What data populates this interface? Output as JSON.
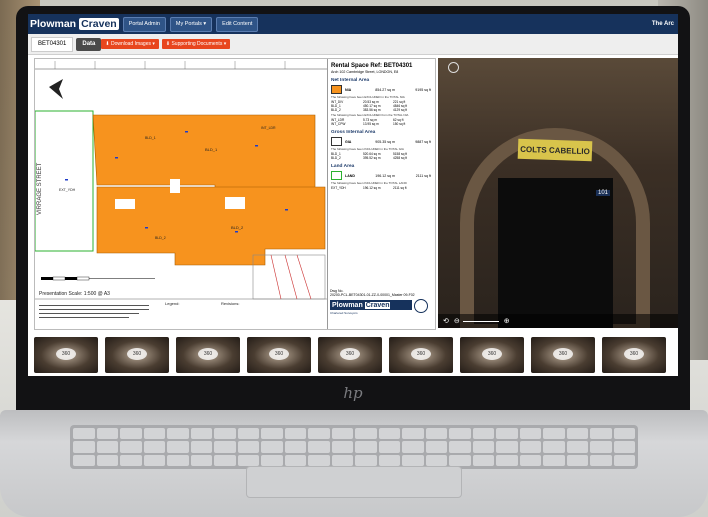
{
  "app": {
    "brand_part1": "Plowman",
    "brand_part2": "Craven",
    "nav": [
      "Portal Admin",
      "My Portals ▾",
      "Edit Content"
    ],
    "right_title": "The Arc"
  },
  "tabs": {
    "ref": "BET04301",
    "data": "Data",
    "download": "⬇ Download Images ▾",
    "supporting": "⬇ Supporting Documents ▾"
  },
  "panel": {
    "title": "Rental Space Ref: BET04301",
    "address": "Arch 102 Cambridge Street, LONDON, E8",
    "nia_heading": "Net Internal Area",
    "nia": {
      "key": "NIA",
      "sqm": "854.27 sq m",
      "sqft": "9195 sq ft"
    },
    "nia_note": "The following have been EXCLUDED in the TOTAL NIA",
    "nia_rows": [
      [
        "INT_DIV",
        "20.53 sq m",
        "221 sq ft"
      ],
      [
        "BLD_1",
        "450.17 sq m",
        "4846 sq ft"
      ],
      [
        "BLD_2",
        "383.56 sq m",
        "4129 sq ft"
      ]
    ],
    "nia_note2": "The following have been EXCLUDED from the TOTAL NIA",
    "nia_rows2": [
      [
        "INT_LDR",
        "5.73 sq m",
        "62 sq ft"
      ],
      [
        "INT_CPW",
        "13.95 sq m",
        "150 sq ft"
      ]
    ],
    "gia_heading": "Gross Internal Area",
    "gia": {
      "key": "GIA",
      "sqm": "905.35 sq m",
      "sqft": "9887 sq ft"
    },
    "gia_note": "The following have been INCLUDED in the TOTAL GIA",
    "gia_rows": [
      [
        "BLD_1",
        "520.64 sq m",
        "5158 sq ft"
      ],
      [
        "BLD_2",
        "395.52 sq m",
        "4258 sq ft"
      ]
    ],
    "land_heading": "Land Area",
    "land": {
      "key": "LAND",
      "sqm": "196.12 sq m",
      "sqft": "2111 sq ft"
    },
    "land_note": "The following have been INCLUDED in the TOTAL LAND",
    "land_rows": [
      [
        "EXT_YDH",
        "196.12 sq m",
        "2111 sq ft"
      ]
    ],
    "dwg_label": "Dwg No.",
    "dwg_no": "20200-PCL-BET04301-01-ZZ-0-00001_Master 09-F02",
    "logo_part1": "Plowman",
    "logo_part2": "Craven",
    "logo_sub": "Chartered Surveyors"
  },
  "plan": {
    "street": "VIRRAGE STREET",
    "scale": "Presentation Scale: 1:500 @ A3",
    "legend_label": "Legend:",
    "revisions_label": "Revisions:",
    "labels": [
      "BLD_1",
      "BLD_2",
      "INT_LDR",
      "EXT_YDH",
      "BLD_1",
      "BLD_2"
    ]
  },
  "photo": {
    "sign": "COLTS CABELLIO",
    "door_no": "101"
  },
  "colors": {
    "nia": "#f7931e",
    "gia": "#ffffff",
    "land": "#ffffff",
    "accent": "#e8461e",
    "brand": "#16325c"
  },
  "tools": [
    "hand-icon",
    "anchor-icon",
    "video-icon",
    "pencil-icon",
    "folder-icon",
    "settings-icon",
    "layers-icon",
    "save-icon",
    "expand-icon"
  ],
  "thumbs": [
    "360",
    "360",
    "360",
    "360",
    "360",
    "360",
    "360",
    "360",
    "360"
  ]
}
